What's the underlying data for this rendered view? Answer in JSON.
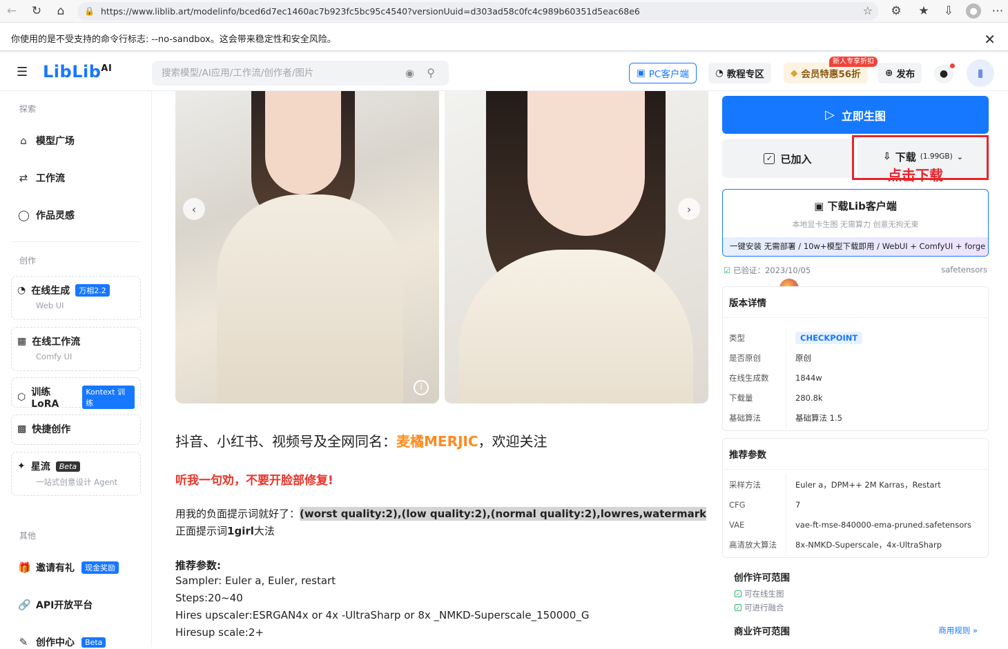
{
  "browser": {
    "url": "https://www.liblib.art/modelinfo/bced6d7ec1460ac7b923fc5bc95c4540?versionUuid=d303ad58c0fc4c989b60351d5eac68e6"
  },
  "notice": {
    "text": "你使用的是不受支持的命令行标志: --no-sandbox。这会带来稳定性和安全风险。"
  },
  "topbar": {
    "logo_text": "LibLib",
    "logo_ai": "AI",
    "search_placeholder": "搜索模型/AI应用/工作流/创作者/图片",
    "pc_client": "PC客户端",
    "tutorial": "教程专区",
    "vip": "会员特惠56折",
    "vip_badge": "新人专享折扣",
    "publish": "发布"
  },
  "sidebar": {
    "section_explore": "探索",
    "model_square": "模型广场",
    "workflow": "工作流",
    "inspiration": "作品灵感",
    "section_create": "创作",
    "online_gen": "在线生成",
    "online_gen_tag": "万相2.2",
    "online_gen_sub": "Web UI",
    "online_workflow": "在线工作流",
    "online_workflow_sub": "Comfy UI",
    "train_lora": "训练LoRA",
    "train_lora_tag": "Kontext 训练",
    "quick_create": "快捷创作",
    "star_flow": "星流",
    "star_flow_tag": "Beta",
    "star_flow_sub": "一站式创意设计 Agent",
    "section_other": "其他",
    "invite": "邀请有礼",
    "invite_tag": "现金奖励",
    "api": "API开放平台",
    "creator_center": "创作中心",
    "creator_tag": "Beta"
  },
  "main": {
    "line1_prefix": "抖音、小红书、视频号及全网同名：",
    "line1_name": "麦橘MERJIC",
    "line1_suffix": "，欢迎关注",
    "warning": "听我一句劝，不要开脸部修复!",
    "neg_prefix": "用我的负面提示词就好了：",
    "neg_prompt": "(worst quality:2),(low quality:2),(normal quality:2),lowres,watermark",
    "pos_prefix": "正面提示词",
    "pos_word": "1girl",
    "pos_suffix": "大法",
    "params_title": "推荐参数:",
    "sampler": "Sampler: Euler a, Euler, restart",
    "steps": "Steps:20~40",
    "upscaler": "Hires upscaler:ESRGAN4x or 4x -UltraSharp or 8x _NMKD-Superscale_150000_G",
    "scale": "Hiresup scale:2+"
  },
  "right": {
    "generate": "立即生图",
    "added": "已加入",
    "download": "下载",
    "download_size": "(1.99GB)",
    "annotation": "点击下载",
    "client_title": "下载Lib客户端",
    "client_sub": "本地显卡生图 无需算力 创意无拘无束",
    "client_banner": "一键安装 无需部署 / 10w+模型下载即用 / WebUI + ComfyUI + forge",
    "verified": "已验证：2023/10/05",
    "format": "safetensors",
    "version_title": "版本详情",
    "version": [
      {
        "k": "类型",
        "v": "CHECKPOINT"
      },
      {
        "k": "是否原创",
        "v": "原创"
      },
      {
        "k": "在线生成数",
        "v": "1844w"
      },
      {
        "k": "下载量",
        "v": "280.8k"
      },
      {
        "k": "基础算法",
        "v": "基础算法 1.5"
      }
    ],
    "params_title": "推荐参数",
    "params": [
      {
        "k": "采样方法",
        "v": "Euler a，DPM++ 2M Karras，Restart"
      },
      {
        "k": "CFG",
        "v": "7"
      },
      {
        "k": "VAE",
        "v": "vae-ft-mse-840000-ema-pruned.safetensors"
      },
      {
        "k": "高清放大算法",
        "v": "8x-NMKD-Superscale，4x-UltraSharp"
      }
    ],
    "license_title": "创作许可范围",
    "license_1": "可在线生图",
    "license_2": "可进行融合",
    "commercial_title": "商业许可范围",
    "commercial_rules": "商用规则 »"
  },
  "colors": {
    "primary": "#1677ff",
    "orange": "#ff8a1f",
    "red": "#e8352a"
  }
}
